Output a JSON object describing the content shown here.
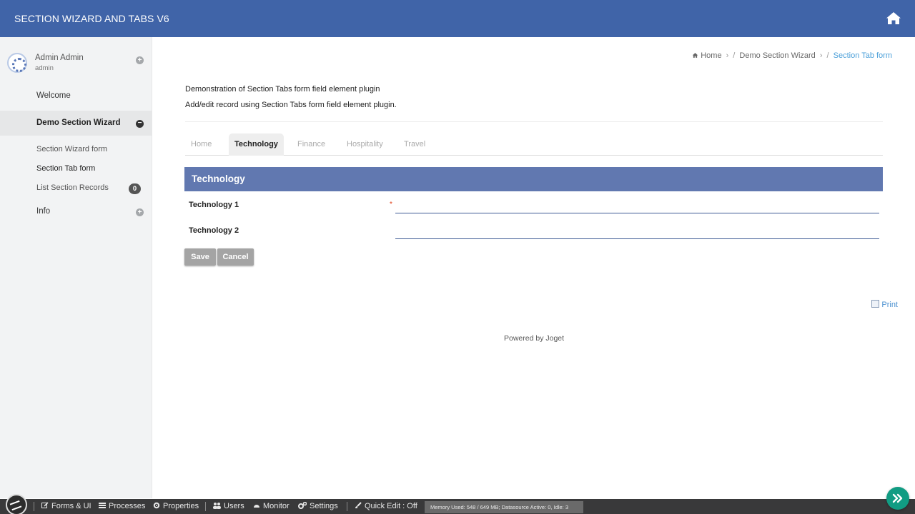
{
  "app": {
    "title": "SECTION WIZARD AND TABS V6"
  },
  "user": {
    "name": "Admin Admin",
    "username": "admin"
  },
  "sidebar": {
    "items": [
      {
        "label": "Welcome"
      },
      {
        "label": "Demo Section Wizard"
      },
      {
        "label": "Section Wizard form"
      },
      {
        "label": "Section Tab form"
      },
      {
        "label": "List Section Records",
        "badge": "0"
      },
      {
        "label": "Info"
      }
    ]
  },
  "breadcrumb": {
    "items": [
      "Home",
      "Demo Section Wizard",
      "Section Tab form"
    ],
    "sep": "/"
  },
  "main": {
    "description1": "Demonstration of Section Tabs form field element plugin",
    "description2": "Add/edit record using Section Tabs form field element plugin.",
    "tabs": [
      "Home",
      "Technology",
      "Finance",
      "Hospitality",
      "Travel"
    ],
    "active_tab": "Technology",
    "section_title": "Technology",
    "fields": [
      {
        "label": "Technology 1",
        "value": "",
        "required_mark": "*"
      },
      {
        "label": "Technology 2",
        "value": ""
      }
    ],
    "save_label": "Save",
    "cancel_label": "Cancel",
    "print_label": "Print",
    "powered_by": "Powered by Joget"
  },
  "bottombar": {
    "items": [
      "Forms & UI",
      "Processes",
      "Properties",
      "Users",
      "Monitor",
      "Settings",
      "Quick Edit : Off"
    ],
    "memory": "Memory Used: 548 / 649 MB; Datasource Active: 0, Idle: 3"
  },
  "colors": {
    "header": "#4064a8",
    "section_header": "#6178b0",
    "link": "#4a9fd9",
    "fab": "#119c83",
    "bottombar": "#39393a"
  }
}
